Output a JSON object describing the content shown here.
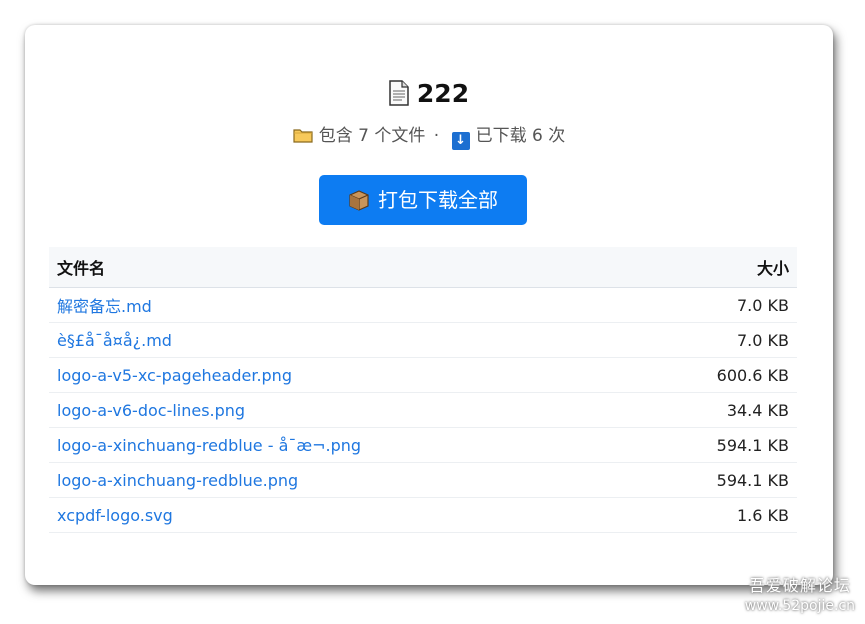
{
  "header": {
    "title": "222",
    "folder_icon": "folder-icon",
    "file_count_text": "包含 7 个文件",
    "separator": "·",
    "download_icon": "download-icon",
    "download_count_text": "已下载 6 次"
  },
  "download_button": {
    "icon": "package-icon",
    "label": "打包下载全部"
  },
  "table": {
    "headers": {
      "name": "文件名",
      "size": "大小"
    },
    "rows": [
      {
        "name": "解密备忘.md",
        "size": "7.0 KB"
      },
      {
        "name": "è§£å¯å¤å¿.md",
        "size": "7.0 KB"
      },
      {
        "name": "logo-a-v5-xc-pageheader.png",
        "size": "600.6 KB"
      },
      {
        "name": "logo-a-v6-doc-lines.png",
        "size": "34.4 KB"
      },
      {
        "name": "logo-a-xinchuang-redblue - å¯æ¬.png",
        "size": "594.1 KB"
      },
      {
        "name": "logo-a-xinchuang-redblue.png",
        "size": "594.1 KB"
      },
      {
        "name": "xcpdf-logo.svg",
        "size": "1.6 KB"
      }
    ]
  },
  "colors": {
    "accent": "#0d7cf2",
    "link": "#1f77e0"
  },
  "watermark": {
    "line1": "吾爱破解论坛",
    "line2": "www.52pojie.cn"
  }
}
